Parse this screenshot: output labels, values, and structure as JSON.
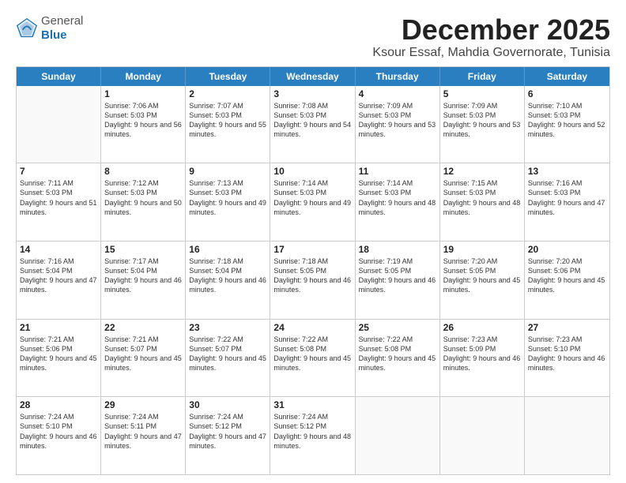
{
  "header": {
    "logo_general": "General",
    "logo_blue": "Blue",
    "month_title": "December 2025",
    "subtitle": "Ksour Essaf, Mahdia Governorate, Tunisia"
  },
  "days_of_week": [
    "Sunday",
    "Monday",
    "Tuesday",
    "Wednesday",
    "Thursday",
    "Friday",
    "Saturday"
  ],
  "weeks": [
    [
      {
        "day": "",
        "sunrise": "",
        "sunset": "",
        "daylight": ""
      },
      {
        "day": "1",
        "sunrise": "Sunrise: 7:06 AM",
        "sunset": "Sunset: 5:03 PM",
        "daylight": "Daylight: 9 hours and 56 minutes."
      },
      {
        "day": "2",
        "sunrise": "Sunrise: 7:07 AM",
        "sunset": "Sunset: 5:03 PM",
        "daylight": "Daylight: 9 hours and 55 minutes."
      },
      {
        "day": "3",
        "sunrise": "Sunrise: 7:08 AM",
        "sunset": "Sunset: 5:03 PM",
        "daylight": "Daylight: 9 hours and 54 minutes."
      },
      {
        "day": "4",
        "sunrise": "Sunrise: 7:09 AM",
        "sunset": "Sunset: 5:03 PM",
        "daylight": "Daylight: 9 hours and 53 minutes."
      },
      {
        "day": "5",
        "sunrise": "Sunrise: 7:09 AM",
        "sunset": "Sunset: 5:03 PM",
        "daylight": "Daylight: 9 hours and 53 minutes."
      },
      {
        "day": "6",
        "sunrise": "Sunrise: 7:10 AM",
        "sunset": "Sunset: 5:03 PM",
        "daylight": "Daylight: 9 hours and 52 minutes."
      }
    ],
    [
      {
        "day": "7",
        "sunrise": "Sunrise: 7:11 AM",
        "sunset": "Sunset: 5:03 PM",
        "daylight": "Daylight: 9 hours and 51 minutes."
      },
      {
        "day": "8",
        "sunrise": "Sunrise: 7:12 AM",
        "sunset": "Sunset: 5:03 PM",
        "daylight": "Daylight: 9 hours and 50 minutes."
      },
      {
        "day": "9",
        "sunrise": "Sunrise: 7:13 AM",
        "sunset": "Sunset: 5:03 PM",
        "daylight": "Daylight: 9 hours and 49 minutes."
      },
      {
        "day": "10",
        "sunrise": "Sunrise: 7:14 AM",
        "sunset": "Sunset: 5:03 PM",
        "daylight": "Daylight: 9 hours and 49 minutes."
      },
      {
        "day": "11",
        "sunrise": "Sunrise: 7:14 AM",
        "sunset": "Sunset: 5:03 PM",
        "daylight": "Daylight: 9 hours and 48 minutes."
      },
      {
        "day": "12",
        "sunrise": "Sunrise: 7:15 AM",
        "sunset": "Sunset: 5:03 PM",
        "daylight": "Daylight: 9 hours and 48 minutes."
      },
      {
        "day": "13",
        "sunrise": "Sunrise: 7:16 AM",
        "sunset": "Sunset: 5:03 PM",
        "daylight": "Daylight: 9 hours and 47 minutes."
      }
    ],
    [
      {
        "day": "14",
        "sunrise": "Sunrise: 7:16 AM",
        "sunset": "Sunset: 5:04 PM",
        "daylight": "Daylight: 9 hours and 47 minutes."
      },
      {
        "day": "15",
        "sunrise": "Sunrise: 7:17 AM",
        "sunset": "Sunset: 5:04 PM",
        "daylight": "Daylight: 9 hours and 46 minutes."
      },
      {
        "day": "16",
        "sunrise": "Sunrise: 7:18 AM",
        "sunset": "Sunset: 5:04 PM",
        "daylight": "Daylight: 9 hours and 46 minutes."
      },
      {
        "day": "17",
        "sunrise": "Sunrise: 7:18 AM",
        "sunset": "Sunset: 5:05 PM",
        "daylight": "Daylight: 9 hours and 46 minutes."
      },
      {
        "day": "18",
        "sunrise": "Sunrise: 7:19 AM",
        "sunset": "Sunset: 5:05 PM",
        "daylight": "Daylight: 9 hours and 46 minutes."
      },
      {
        "day": "19",
        "sunrise": "Sunrise: 7:20 AM",
        "sunset": "Sunset: 5:05 PM",
        "daylight": "Daylight: 9 hours and 45 minutes."
      },
      {
        "day": "20",
        "sunrise": "Sunrise: 7:20 AM",
        "sunset": "Sunset: 5:06 PM",
        "daylight": "Daylight: 9 hours and 45 minutes."
      }
    ],
    [
      {
        "day": "21",
        "sunrise": "Sunrise: 7:21 AM",
        "sunset": "Sunset: 5:06 PM",
        "daylight": "Daylight: 9 hours and 45 minutes."
      },
      {
        "day": "22",
        "sunrise": "Sunrise: 7:21 AM",
        "sunset": "Sunset: 5:07 PM",
        "daylight": "Daylight: 9 hours and 45 minutes."
      },
      {
        "day": "23",
        "sunrise": "Sunrise: 7:22 AM",
        "sunset": "Sunset: 5:07 PM",
        "daylight": "Daylight: 9 hours and 45 minutes."
      },
      {
        "day": "24",
        "sunrise": "Sunrise: 7:22 AM",
        "sunset": "Sunset: 5:08 PM",
        "daylight": "Daylight: 9 hours and 45 minutes."
      },
      {
        "day": "25",
        "sunrise": "Sunrise: 7:22 AM",
        "sunset": "Sunset: 5:08 PM",
        "daylight": "Daylight: 9 hours and 45 minutes."
      },
      {
        "day": "26",
        "sunrise": "Sunrise: 7:23 AM",
        "sunset": "Sunset: 5:09 PM",
        "daylight": "Daylight: 9 hours and 46 minutes."
      },
      {
        "day": "27",
        "sunrise": "Sunrise: 7:23 AM",
        "sunset": "Sunset: 5:10 PM",
        "daylight": "Daylight: 9 hours and 46 minutes."
      }
    ],
    [
      {
        "day": "28",
        "sunrise": "Sunrise: 7:24 AM",
        "sunset": "Sunset: 5:10 PM",
        "daylight": "Daylight: 9 hours and 46 minutes."
      },
      {
        "day": "29",
        "sunrise": "Sunrise: 7:24 AM",
        "sunset": "Sunset: 5:11 PM",
        "daylight": "Daylight: 9 hours and 47 minutes."
      },
      {
        "day": "30",
        "sunrise": "Sunrise: 7:24 AM",
        "sunset": "Sunset: 5:12 PM",
        "daylight": "Daylight: 9 hours and 47 minutes."
      },
      {
        "day": "31",
        "sunrise": "Sunrise: 7:24 AM",
        "sunset": "Sunset: 5:12 PM",
        "daylight": "Daylight: 9 hours and 48 minutes."
      },
      {
        "day": "",
        "sunrise": "",
        "sunset": "",
        "daylight": ""
      },
      {
        "day": "",
        "sunrise": "",
        "sunset": "",
        "daylight": ""
      },
      {
        "day": "",
        "sunrise": "",
        "sunset": "",
        "daylight": ""
      }
    ]
  ]
}
